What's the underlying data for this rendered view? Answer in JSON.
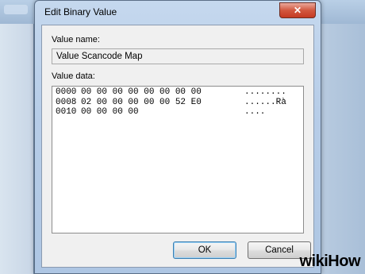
{
  "window": {
    "title": "Edit Binary Value",
    "close_glyph": "✕"
  },
  "value_name": {
    "label": "Value name:",
    "value": "Value Scancode Map"
  },
  "value_data": {
    "label": "Value data:",
    "rows": [
      {
        "addr": "0000",
        "bytes": "00 00 00 00 00 00 00 00",
        "ascii": "........"
      },
      {
        "addr": "0008",
        "bytes": "02 00 00 00 00 00 52 E0",
        "ascii": "......Rà"
      },
      {
        "addr": "0010",
        "bytes": "00 00 00 00",
        "ascii": "...."
      }
    ]
  },
  "buttons": {
    "ok": "OK",
    "cancel": "Cancel"
  },
  "watermark": "wikiHow",
  "colors": {
    "ok_border": "#3c7fb1",
    "close_red": "#c53a22"
  }
}
